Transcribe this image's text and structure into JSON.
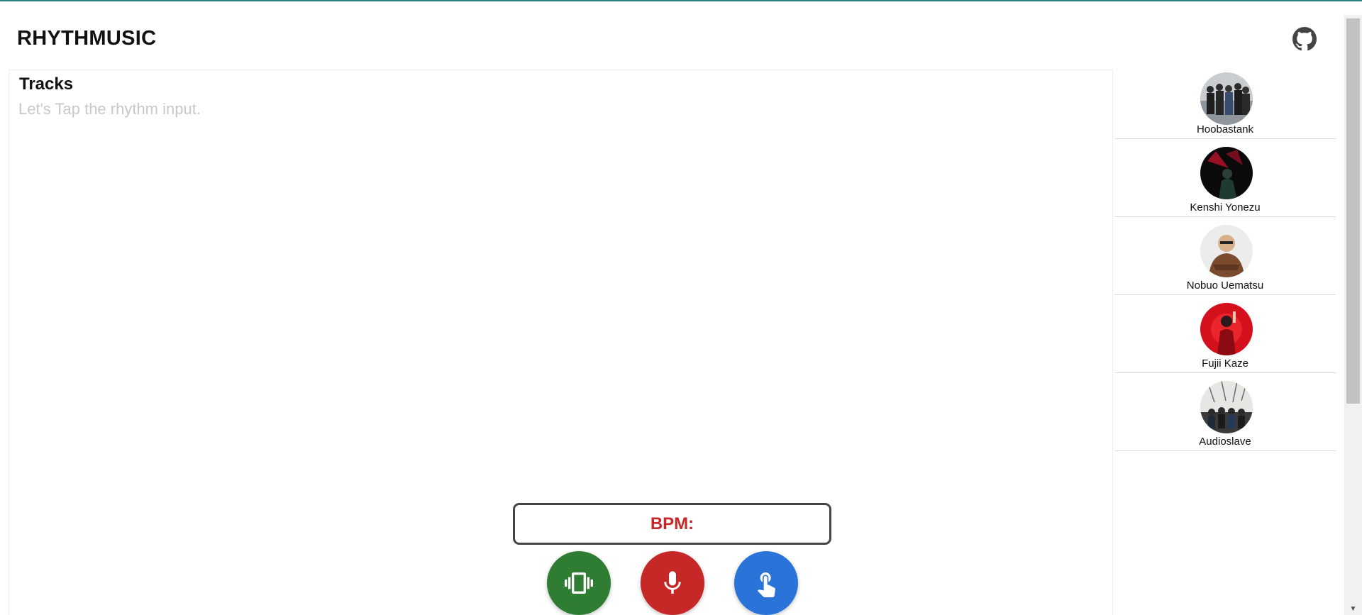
{
  "header": {
    "title": "RHYTHMUSIC",
    "github_icon": "github-icon"
  },
  "tracks": {
    "heading": "Tracks",
    "placeholder": "Let's Tap the rhythm input."
  },
  "artists": [
    {
      "name": "Hoobastank"
    },
    {
      "name": "Kenshi Yonezu"
    },
    {
      "name": "Nobuo Uematsu"
    },
    {
      "name": "Fujii Kaze"
    },
    {
      "name": "Audioslave"
    }
  ],
  "bpm": {
    "label": "BPM:"
  },
  "controls": [
    {
      "icon": "vibrate-icon",
      "color": "#2e7d32"
    },
    {
      "icon": "microphone-icon",
      "color": "#c62828"
    },
    {
      "icon": "tap-hand-icon",
      "color": "#2a73d9"
    }
  ],
  "colors": {
    "accent_line": "#2f7f86",
    "bpm_text": "#c62828",
    "placeholder_text": "#c8c8c8"
  }
}
